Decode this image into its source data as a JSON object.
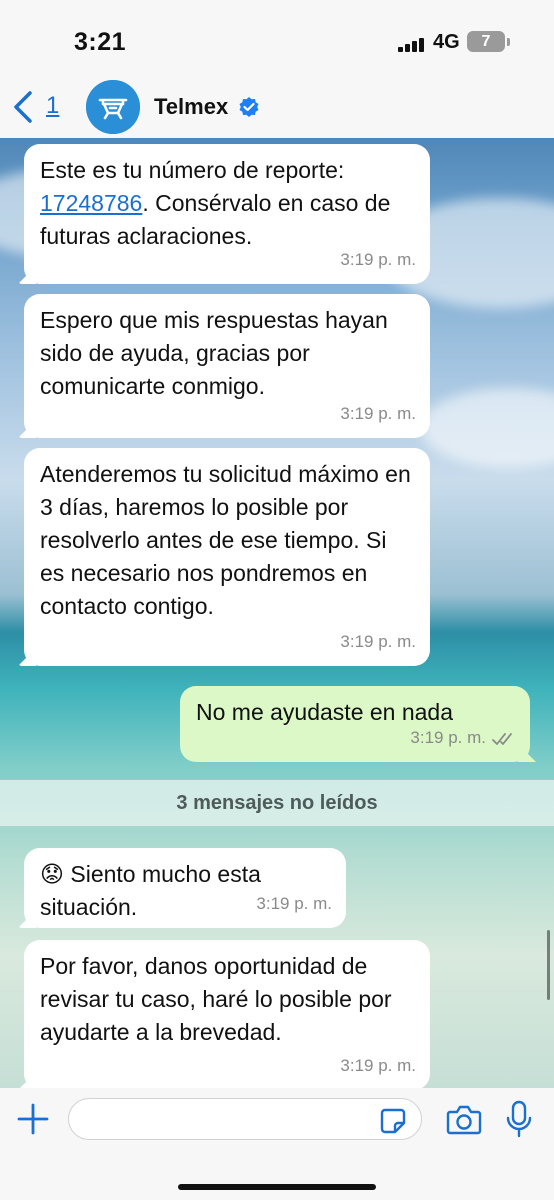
{
  "status_bar": {
    "time": "3:21",
    "network": "4G",
    "battery": "7"
  },
  "header": {
    "back_count": "1",
    "contact_name": "Telmex",
    "avatar_icon": "telmex-logo",
    "verified_icon": "verified-badge-icon",
    "accent_color": "#1a6fd0"
  },
  "messages": [
    {
      "direction": "incoming",
      "text_before_link": "Este es tu número de reporte: ",
      "link": "17248786",
      "text_after_link": ". Consérvalo en caso de futuras aclaraciones.",
      "time": "3:19 p. m."
    },
    {
      "direction": "incoming",
      "text": "Espero que mis respuestas hayan sido de ayuda, gracias por comunicarte conmigo.",
      "time": "3:19 p. m."
    },
    {
      "direction": "incoming",
      "text": "Atenderemos tu solicitud máximo en 3 días, haremos lo posible por resolverlo antes de ese tiempo. Si es necesario nos pondremos en contacto contigo.",
      "time": "3:19 p. m."
    },
    {
      "direction": "outgoing",
      "text": "No me ayudaste en nada",
      "time": "3:19 p. m.",
      "status": "delivered"
    },
    {
      "direction": "incoming",
      "text": "😟 Siento mucho esta situación.",
      "time": "3:19 p. m."
    },
    {
      "direction": "incoming",
      "text": "Por favor, danos oportunidad de revisar tu caso, haré lo posible por ayudarte a la brevedad.",
      "time": "3:19 p. m."
    }
  ],
  "unread_banner": "3 mensajes no leídos",
  "input": {
    "placeholder": "",
    "value": ""
  }
}
